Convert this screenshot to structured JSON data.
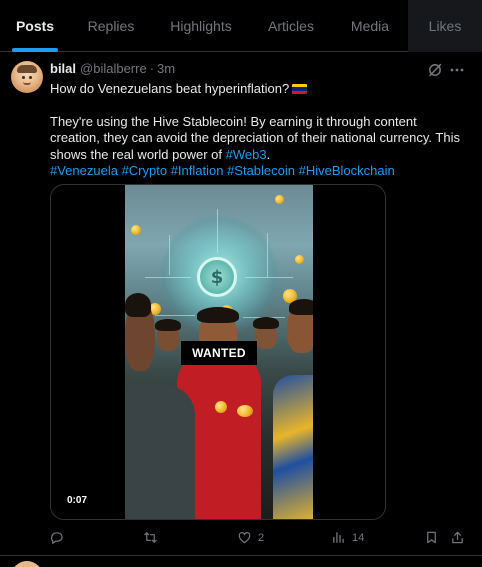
{
  "tabs": [
    {
      "label": "Posts",
      "active": true
    },
    {
      "label": "Replies"
    },
    {
      "label": "Highlights"
    },
    {
      "label": "Articles"
    },
    {
      "label": "Media"
    },
    {
      "label": "Likes"
    }
  ],
  "post": {
    "author_name": "bilal",
    "author_handle": "@bilalberre",
    "separator": "·",
    "time": "3m",
    "line1": "How do Venezuelans beat hyperinflation?",
    "para2": "They're using the Hive Stablecoin! By earning it through content creation, they can avoid the depreciation of their national currency. This shows the real world power of",
    "link_web3": "#Web3",
    "period": ".",
    "hashtags": "#Venezuela #Crypto #Inflation #Stablecoin #HiveBlockchain",
    "media": {
      "overlay_text": "WANTED",
      "duration": "0:07"
    },
    "actions": {
      "reply_count": "",
      "repost_count": "",
      "like_count": "2",
      "views_count": "14"
    }
  },
  "colors": {
    "accent": "#1d9bf0",
    "muted": "#71767b",
    "text": "#e7e9ea",
    "border": "#2f3336"
  },
  "icons": {
    "grok": "grok-icon",
    "more": "more-dots-icon",
    "reply": "reply-icon",
    "repost": "repost-icon",
    "like": "heart-icon",
    "views": "views-chart-icon",
    "bookmark": "bookmark-icon",
    "share": "share-icon"
  }
}
